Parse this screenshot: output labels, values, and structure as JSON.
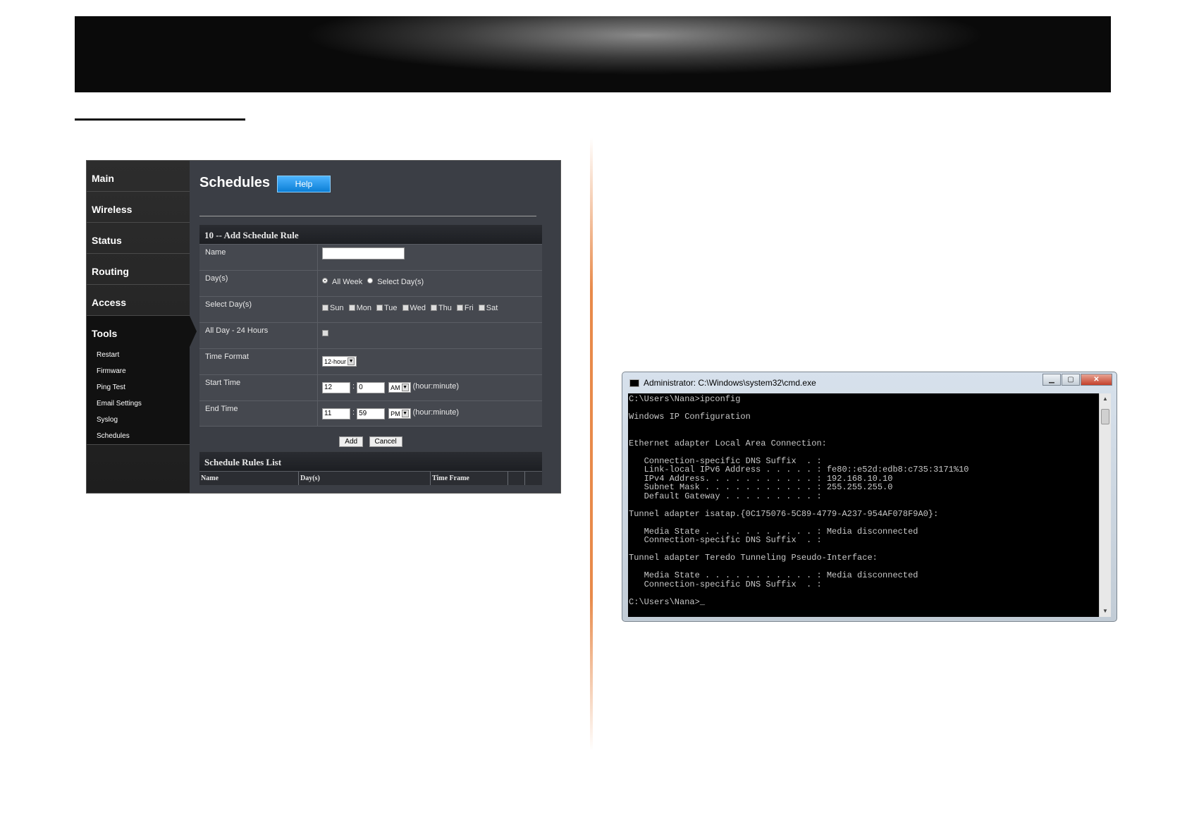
{
  "router": {
    "nav": [
      "Main",
      "Wireless",
      "Status",
      "Routing",
      "Access"
    ],
    "active_nav": "Tools",
    "subnav": [
      "Restart",
      "Firmware",
      "Ping Test",
      "Email Settings",
      "Syslog",
      "Schedules"
    ],
    "page_title": "Schedules",
    "help_label": "Help",
    "form": {
      "title": "10 -- Add Schedule Rule",
      "name_label": "Name",
      "days_label": "Day(s)",
      "all_week": "All Week",
      "select_days_option": "Select Day(s)",
      "select_days_label": "Select Day(s)",
      "weekdays": [
        "Sun",
        "Mon",
        "Tue",
        "Wed",
        "Thu",
        "Fri",
        "Sat"
      ],
      "allday_label": "All Day - 24 Hours",
      "time_format_label": "Time Format",
      "time_format_value": "12-hour",
      "start_label": "Start Time",
      "start_hour": "12",
      "start_minute": "0",
      "start_ampm": "AM",
      "end_label": "End Time",
      "end_hour": "11",
      "end_minute": "59",
      "end_ampm": "PM",
      "hour_minute": "(hour:minute)",
      "add_label": "Add",
      "cancel_label": "Cancel"
    },
    "list": {
      "title": "Schedule Rules List",
      "columns": [
        "Name",
        "Day(s)",
        "Time Frame"
      ]
    }
  },
  "cmd": {
    "title": "Administrator: C:\\Windows\\system32\\cmd.exe",
    "lines": [
      "C:\\Users\\Nana>ipconfig",
      "",
      "Windows IP Configuration",
      "",
      "",
      "Ethernet adapter Local Area Connection:",
      "",
      "   Connection-specific DNS Suffix  . :",
      "   Link-local IPv6 Address . . . . . : fe80::e52d:edb8:c735:3171%10",
      "   IPv4 Address. . . . . . . . . . . : 192.168.10.10",
      "   Subnet Mask . . . . . . . . . . . : 255.255.255.0",
      "   Default Gateway . . . . . . . . . :",
      "",
      "Tunnel adapter isatap.{0C175076-5C89-4779-A237-954AF078F9A0}:",
      "",
      "   Media State . . . . . . . . . . . : Media disconnected",
      "   Connection-specific DNS Suffix  . :",
      "",
      "Tunnel adapter Teredo Tunneling Pseudo-Interface:",
      "",
      "   Media State . . . . . . . . . . . : Media disconnected",
      "   Connection-specific DNS Suffix  . :",
      "",
      "C:\\Users\\Nana>_"
    ]
  }
}
